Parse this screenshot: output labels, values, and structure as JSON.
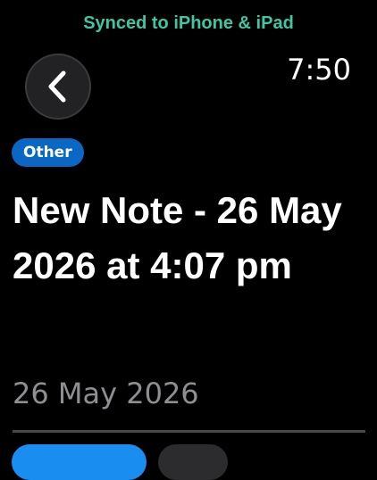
{
  "status": {
    "sync_banner": "Synced to iPhone & iPad",
    "time": "7:50"
  },
  "nav": {
    "back_icon": "chevron-left-icon"
  },
  "note": {
    "category": "Other",
    "title": "New Note - 26 May 2026 at 4:07 pm",
    "date": "26 May 2026"
  },
  "colors": {
    "background": "#000000",
    "sync_banner": "#3cc8a4",
    "category_pill": "#0a67c4",
    "primary_action": "#1a8ef0",
    "secondary_action": "#2c2c2e",
    "secondary_text": "#8e8e93"
  }
}
